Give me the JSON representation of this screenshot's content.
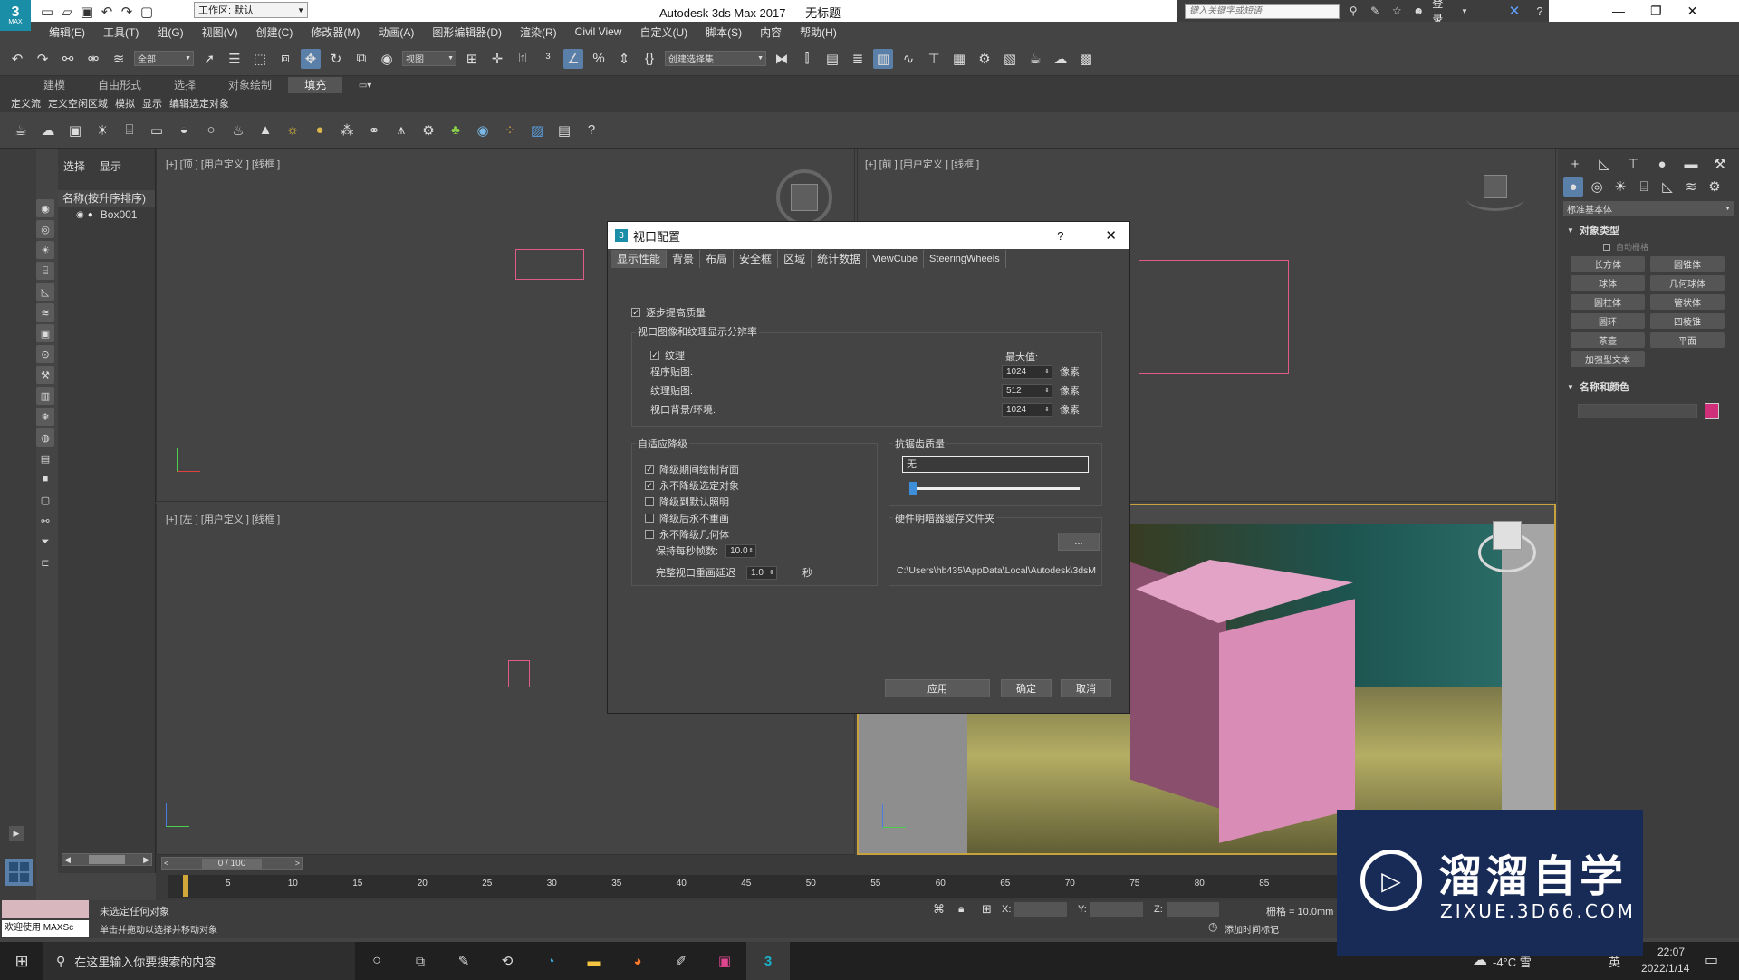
{
  "titlebar": {
    "app_icon_text": "3",
    "app_icon_sub": "MAX",
    "workspace": "工作区: 默认",
    "title": "Autodesk 3ds Max 2017",
    "doc": "无标题",
    "search_placeholder": "键入关键字或短语",
    "login": "登录"
  },
  "menu": [
    "编辑(E)",
    "工具(T)",
    "组(G)",
    "视图(V)",
    "创建(C)",
    "修改器(M)",
    "动画(A)",
    "图形编辑器(D)",
    "渲染(R)",
    "Civil View",
    "自定义(U)",
    "脚本(S)",
    "内容",
    "帮助(H)"
  ],
  "toolbar": {
    "filter": "全部",
    "refcoord": "视图",
    "selset": "创建选择集"
  },
  "ribbon": {
    "tabs": [
      "建模",
      "自由形式",
      "选择",
      "对象绘制",
      "填充"
    ],
    "subtabs": [
      "定义流",
      "定义空闲区域",
      "模拟",
      "显示",
      "编辑选定对象"
    ]
  },
  "explorer": {
    "tabs": [
      "选择",
      "显示"
    ],
    "header": "名称(按升序排序)",
    "item": "Box001"
  },
  "viewports": {
    "top_left": "[+] [顶 ] [用户定义 ] [线框 ]",
    "top_right": "[+] [前 ] [用户定义 ] [线框 ]",
    "bottom_left": "[+] [左 ] [用户定义 ] [线框 ]"
  },
  "cmdpanel": {
    "dropdown": "标准基本体",
    "section_object_type": "对象类型",
    "auto_grid": "自动栅格",
    "buttons": [
      "长方体",
      "圆锥体",
      "球体",
      "几何球体",
      "圆柱体",
      "管状体",
      "圆环",
      "四棱锥",
      "茶壶",
      "平面",
      "加强型文本"
    ],
    "section_name_color": "名称和颜色",
    "name_color": "#d02f7a"
  },
  "dialog": {
    "icon": "3",
    "title": "视口配置",
    "help": "?",
    "tabs": [
      "显示性能",
      "背景",
      "布局",
      "安全框",
      "区域",
      "统计数据",
      "ViewCube",
      "SteeringWheels"
    ],
    "progressive": "逐步提高质量",
    "res_group": "视口图像和纹理显示分辨率",
    "texture": "纹理",
    "max_label": "最大值:",
    "rows": [
      {
        "label": "程序贴图:",
        "value": "1024",
        "unit": "像素"
      },
      {
        "label": "纹理贴图:",
        "value": "512",
        "unit": "像素"
      },
      {
        "label": "视口背景/环境:",
        "value": "1024",
        "unit": "像素"
      }
    ],
    "adaptive_group": "自适应降级",
    "adaptive": [
      {
        "label": "降级期间绘制背面",
        "checked": true
      },
      {
        "label": "永不降级选定对象",
        "checked": true
      },
      {
        "label": "降级到默认照明",
        "checked": false
      },
      {
        "label": "降级后永不重画",
        "checked": false
      },
      {
        "label": "永不降级几何体",
        "checked": false
      }
    ],
    "fps_label": "保持每秒帧数:",
    "fps_value": "10.0",
    "delay_label": "完整视口重画延迟",
    "delay_value": "1.0",
    "delay_unit": "秒",
    "aa_group": "抗锯齿质量",
    "aa_value": "无",
    "cache_group": "硬件明暗器缓存文件夹",
    "cache_btn": "...",
    "cache_path": "C:\\Users\\hb435\\AppData\\Local\\Autodesk\\3dsM",
    "apply": "应用",
    "ok": "确定",
    "cancel": "取消"
  },
  "trackbar": {
    "frame": "0 / 100",
    "ticks": [
      "0",
      "5",
      "10",
      "15",
      "20",
      "25",
      "30",
      "35",
      "40",
      "45",
      "50",
      "55",
      "60",
      "65",
      "70",
      "75",
      "80",
      "85"
    ]
  },
  "status": {
    "welcome": "欢迎使用 MAXSc",
    "no_selection": "未选定任何对象",
    "hint": "单击并拖动以选择并移动对象",
    "x": "X:",
    "y": "Y:",
    "z": "Z:",
    "grid": "栅格 = 10.0mm",
    "add_time_tag": "添加时间标记"
  },
  "taskbar": {
    "search": "在这里输入你要搜索的内容",
    "temp": "-4°C 雪",
    "lang": "英",
    "time": "22:07",
    "date": "2022/1/14"
  },
  "watermark": {
    "brand": "溜溜自学",
    "url": "ZIXUE.3D66.COM"
  }
}
